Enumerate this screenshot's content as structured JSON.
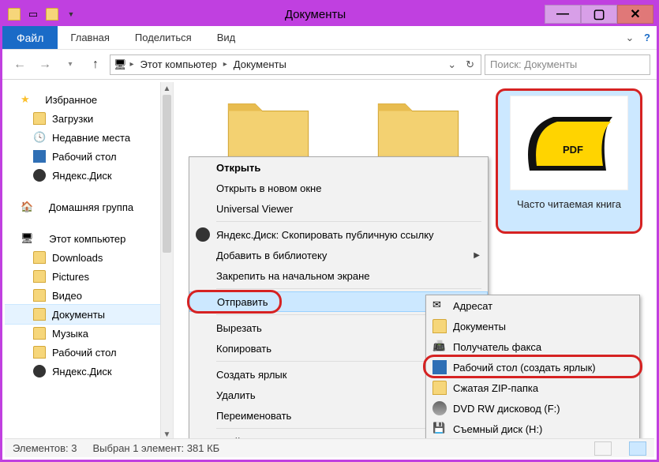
{
  "title": "Документы",
  "ribbon": {
    "file": "Файл",
    "tabs": [
      "Главная",
      "Поделиться",
      "Вид"
    ]
  },
  "breadcrumbs": [
    "Этот компьютер",
    "Документы"
  ],
  "search": {
    "placeholder": "Поиск: Документы"
  },
  "sidebar": {
    "groups": [
      {
        "header": "Избранное",
        "icon": "star",
        "items": [
          {
            "label": "Загрузки",
            "icon": "folder"
          },
          {
            "label": "Недавние места",
            "icon": "places"
          },
          {
            "label": "Рабочий стол",
            "icon": "desktop"
          },
          {
            "label": "Яндекс.Диск",
            "icon": "cloud"
          }
        ]
      },
      {
        "header": "Домашняя группа",
        "icon": "homegroup",
        "items": []
      },
      {
        "header": "Этот компьютер",
        "icon": "pc",
        "items": [
          {
            "label": "Downloads",
            "icon": "folder"
          },
          {
            "label": "Pictures",
            "icon": "folder"
          },
          {
            "label": "Видео",
            "icon": "folder"
          },
          {
            "label": "Документы",
            "icon": "folder",
            "active": true
          },
          {
            "label": "Музыка",
            "icon": "folder"
          },
          {
            "label": "Рабочий стол",
            "icon": "folder"
          },
          {
            "label": "Яндекс.Диск",
            "icon": "cloud"
          }
        ]
      }
    ]
  },
  "content": {
    "file_highlight": {
      "label": "Часто читаемая книга"
    }
  },
  "context_menu": {
    "items": [
      {
        "label": "Открыть",
        "bold": true
      },
      {
        "label": "Открыть в новом окне"
      },
      {
        "label": "Universal Viewer"
      },
      {
        "sep": true
      },
      {
        "label": "Яндекс.Диск: Скопировать публичную ссылку",
        "icon": "cloud"
      },
      {
        "label": "Добавить в библиотеку",
        "sub": true
      },
      {
        "label": "Закрепить на начальном экране"
      },
      {
        "sep": true
      },
      {
        "label": "Отправить",
        "sub": true,
        "selected": true,
        "pill": true
      },
      {
        "sep": true
      },
      {
        "label": "Вырезать"
      },
      {
        "label": "Копировать"
      },
      {
        "sep": true
      },
      {
        "label": "Создать ярлык"
      },
      {
        "label": "Удалить"
      },
      {
        "label": "Переименовать"
      },
      {
        "sep": true
      },
      {
        "label": "Свойства"
      }
    ]
  },
  "submenu": {
    "items": [
      {
        "label": "Адресат",
        "icon": "mail"
      },
      {
        "label": "Документы",
        "icon": "folder"
      },
      {
        "label": "Получатель факса",
        "icon": "fax"
      },
      {
        "label": "Рабочий стол (создать ярлык)",
        "icon": "desktop",
        "pill": true
      },
      {
        "label": "Сжатая ZIP-папка",
        "icon": "zip"
      },
      {
        "label": "DVD RW дисковод (F:)",
        "icon": "dvd"
      },
      {
        "label": "Съемный диск (H:)",
        "icon": "usb"
      }
    ]
  },
  "status": {
    "count_label": "Элементов:",
    "count": "3",
    "sel_label": "Выбран 1 элемент:",
    "sel_size": "381 КБ"
  }
}
